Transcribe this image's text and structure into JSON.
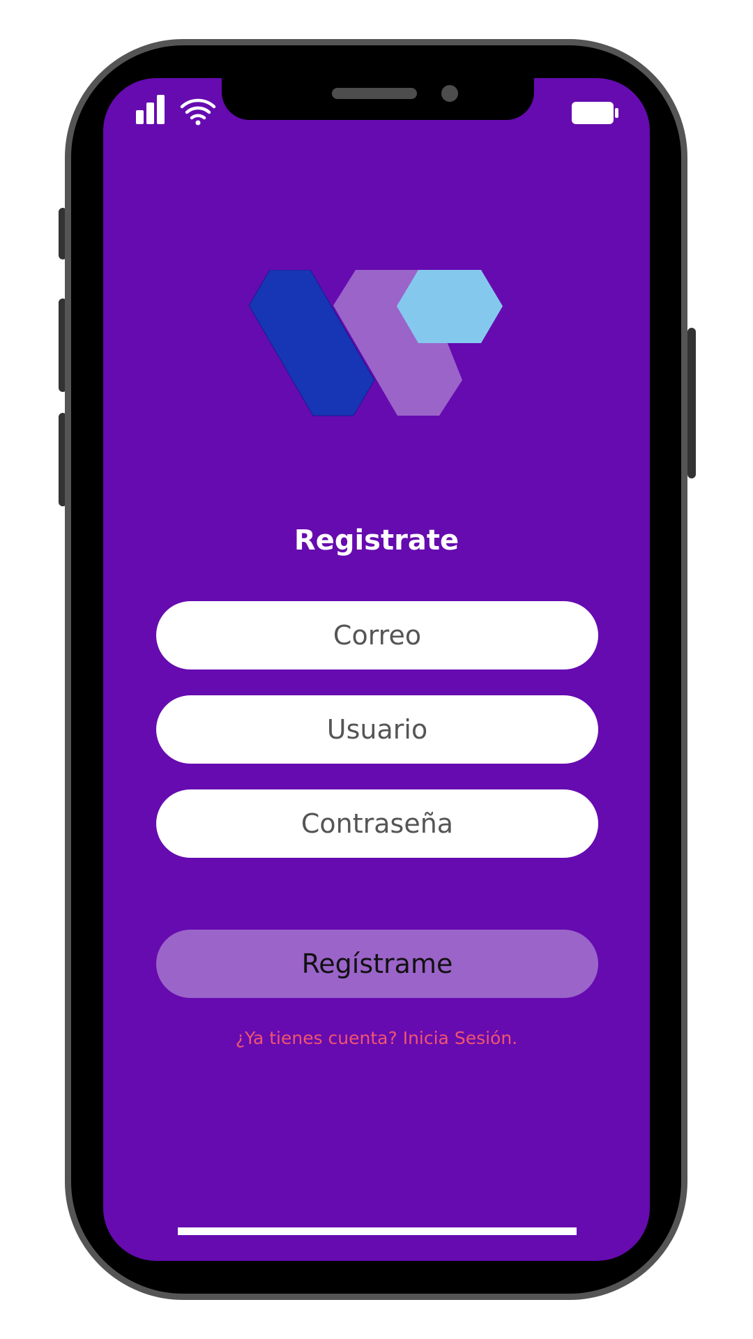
{
  "colors": {
    "screen_background": "#660bb0",
    "phone_frame": "#555555",
    "field_background": "#ffffff",
    "field_text": "#555555",
    "button_background": "#9b64c9",
    "link_text": "#f0556e",
    "logo_dark_blue": "#1736b5",
    "logo_purple": "#9b64c9",
    "logo_light_blue": "#85c8ee"
  },
  "status_bar": {
    "signal_icon": "signal-bars-icon",
    "wifi_icon": "wifi-icon",
    "battery_icon": "battery-icon"
  },
  "logo": {
    "icon": "hexagon-w-logo"
  },
  "form": {
    "title": "Registrate",
    "email_placeholder": "Correo",
    "username_placeholder": "Usuario",
    "password_placeholder": "Contraseña",
    "submit_label": "Regístrame",
    "login_link": "¿Ya tienes cuenta? Inicia Sesión."
  }
}
